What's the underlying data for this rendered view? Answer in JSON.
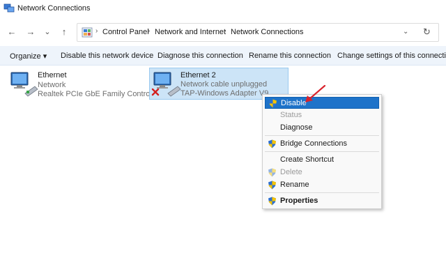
{
  "window": {
    "title": "Network Connections"
  },
  "nav": {
    "back": "←",
    "forward": "→",
    "recent": "⌄",
    "up": "↑",
    "dropdown": "⌄",
    "refresh": "↻"
  },
  "breadcrumb": {
    "items": [
      "Control Panel",
      "Network and Internet",
      "Network Connections"
    ],
    "separator": "›"
  },
  "commands": {
    "organize": "Organize ▾",
    "disable": "Disable this network device",
    "diagnose": "Diagnose this connection",
    "rename": "Rename this connection",
    "change": "Change settings of this connection"
  },
  "adapters": [
    {
      "name": "Ethernet",
      "status": "Network",
      "device": "Realtek PCIe GbE Family Controller",
      "selected": false
    },
    {
      "name": "Ethernet 2",
      "status": "Network cable unplugged",
      "device": "TAP-Windows Adapter V9",
      "selected": true
    }
  ],
  "context_menu": {
    "disable": "Disable",
    "status": "Status",
    "diagnose": "Diagnose",
    "bridge": "Bridge Connections",
    "shortcut": "Create Shortcut",
    "delete": "Delete",
    "rename": "Rename",
    "properties": "Properties"
  },
  "colors": {
    "highlight": "#1e73c9",
    "selected_bg": "#cce4f7",
    "annotation_arrow": "#d9232d"
  }
}
